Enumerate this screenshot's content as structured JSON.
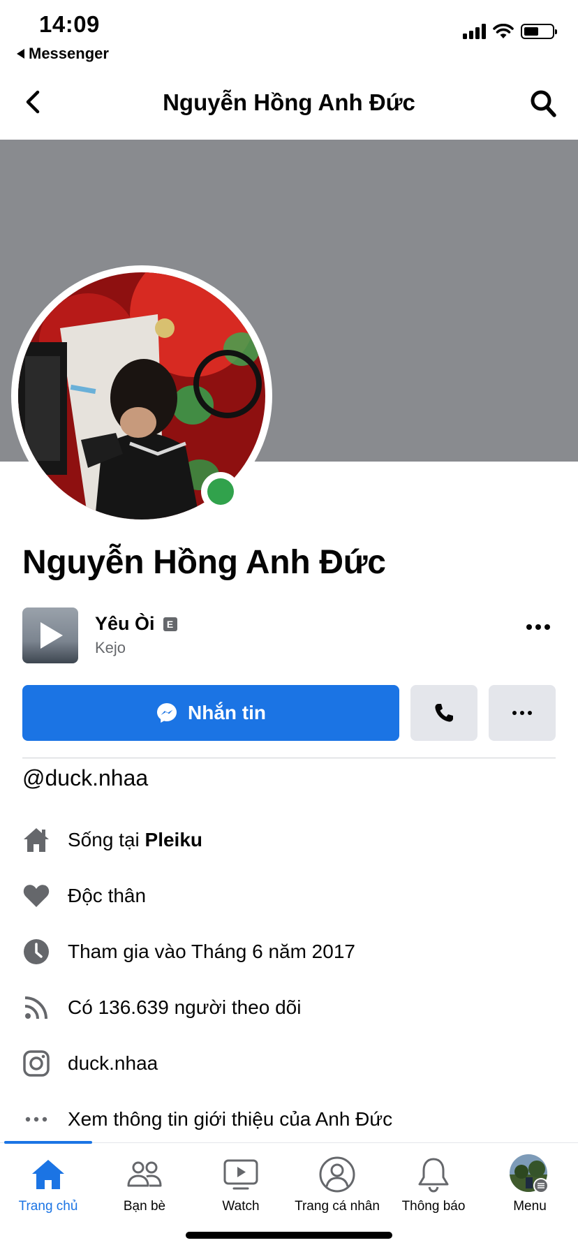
{
  "status_bar": {
    "time": "14:09",
    "back_app": "Messenger"
  },
  "header": {
    "title": "Nguyễn Hồng Anh Đức"
  },
  "profile": {
    "name": "Nguyễn Hồng Anh Đức",
    "online": true,
    "username": "@duck.nhaa"
  },
  "song": {
    "title": "Yêu Òi",
    "explicit_badge": "E",
    "artist": "Kejo"
  },
  "actions": {
    "message_label": "Nhắn tin"
  },
  "info": {
    "lives_prefix": "Sống tại ",
    "lives_city": "Pleiku",
    "relationship": "Độc thân",
    "joined": "Tham gia vào Tháng 6 năm 2017",
    "followers": "Có 136.639 người theo dõi",
    "instagram": "duck.nhaa",
    "see_about": "Xem thông tin giới thiệu của Anh Đức"
  },
  "bottom_nav": {
    "items": [
      {
        "label": "Trang chủ",
        "icon": "home-icon",
        "active": true
      },
      {
        "label": "Bạn bè",
        "icon": "friends-icon",
        "active": false
      },
      {
        "label": "Watch",
        "icon": "watch-icon",
        "active": false
      },
      {
        "label": "Trang cá nhân",
        "icon": "profile-icon",
        "active": false
      },
      {
        "label": "Thông báo",
        "icon": "bell-icon",
        "active": false
      },
      {
        "label": "Menu",
        "icon": "menu-avatar",
        "active": false
      }
    ]
  },
  "colors": {
    "brand_blue": "#1b74e4",
    "online_green": "#31a24c",
    "cover_gray": "#898b8f",
    "secondary_text": "#65676b"
  }
}
